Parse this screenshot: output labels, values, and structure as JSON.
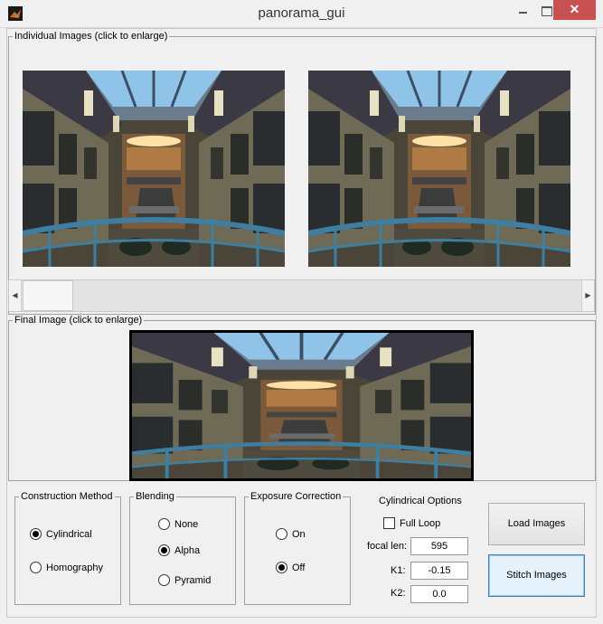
{
  "window": {
    "title": "panorama_gui",
    "close_glyph": "✕"
  },
  "icons": {
    "app": "matlab-logo-icon",
    "minimize": "minimize-icon",
    "maximize": "maximize-icon",
    "close": "close-icon"
  },
  "individual_panel": {
    "legend": "Individual Images (click to enlarge)"
  },
  "final_panel": {
    "legend": "Final Image (click to enlarge)"
  },
  "scrollbar": {
    "left_arrow": "◀",
    "right_arrow": "▶"
  },
  "construction": {
    "legend": "Construction Method",
    "options": [
      "Cylindrical",
      "Homography"
    ],
    "selected": "Cylindrical"
  },
  "blending": {
    "legend": "Blending",
    "options": [
      "None",
      "Alpha",
      "Pyramid"
    ],
    "selected": "Alpha"
  },
  "exposure": {
    "legend": "Exposure Correction",
    "options": [
      "On",
      "Off"
    ],
    "selected": "Off"
  },
  "cylindrical": {
    "title": "Cylindrical Options",
    "full_loop_label": "Full Loop",
    "full_loop_checked": false,
    "focal_label": "focal len:",
    "focal_value": "595",
    "k1_label": "K1:",
    "k1_value": "-0.15",
    "k2_label": "K2:",
    "k2_value": "0.0"
  },
  "buttons": {
    "load": "Load Images",
    "stitch": "Stitch Images"
  }
}
